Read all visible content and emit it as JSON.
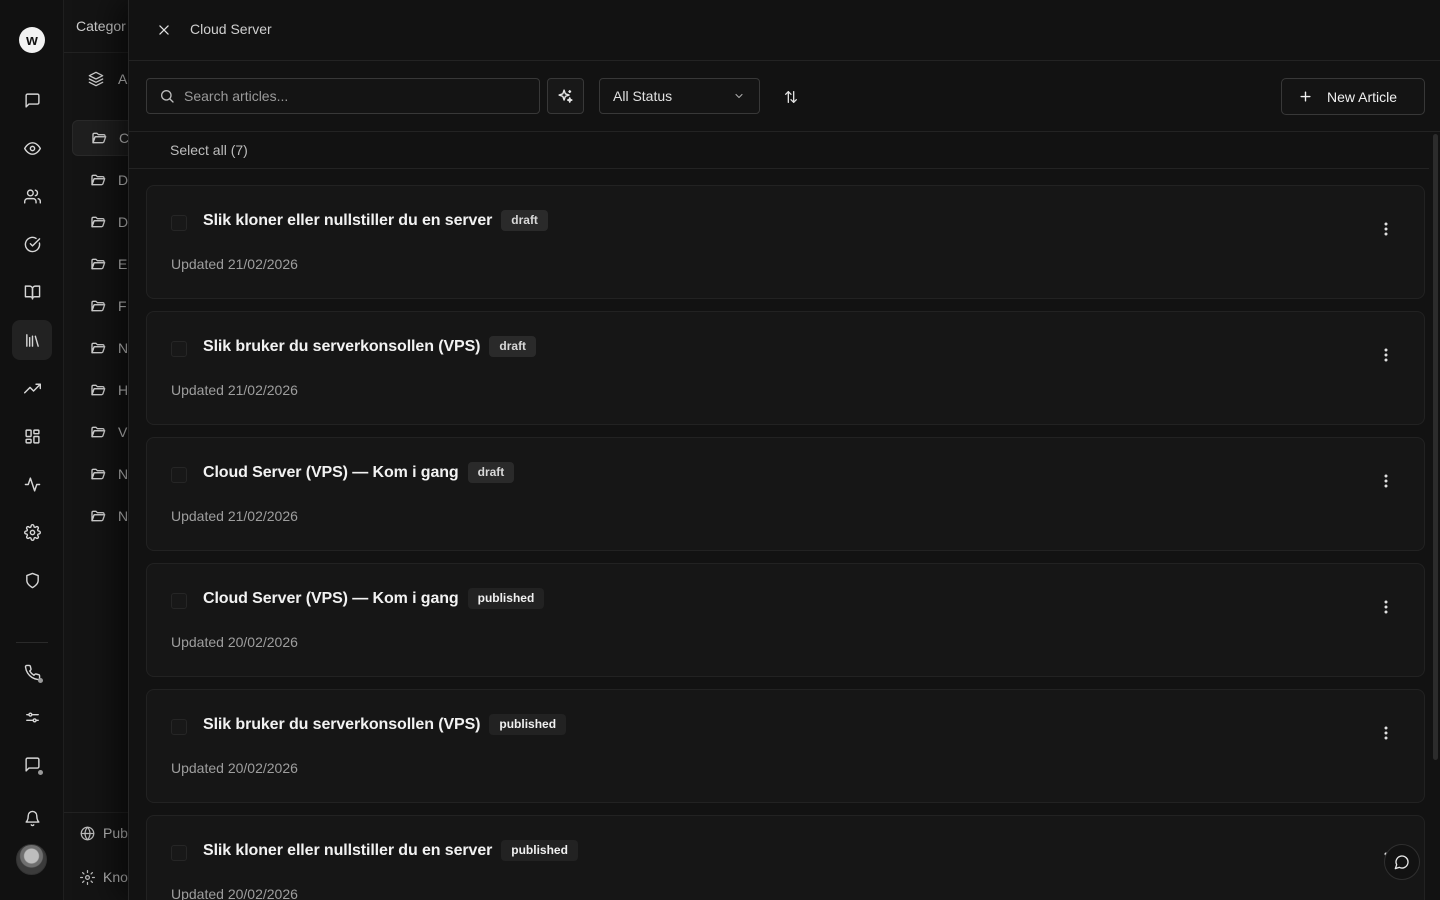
{
  "app": {
    "logo_letter": "w"
  },
  "category_panel": {
    "title": "Categor",
    "all_label": "A",
    "items": [
      {
        "label": "C"
      },
      {
        "label": "D"
      },
      {
        "label": "D"
      },
      {
        "label": "E"
      },
      {
        "label": "F"
      },
      {
        "label": "N"
      },
      {
        "label": "H"
      },
      {
        "label": "V"
      },
      {
        "label": "N"
      },
      {
        "label": "N"
      }
    ],
    "footer_publish": "Pub",
    "footer_knowledge": "Kno"
  },
  "drawer": {
    "title": "Cloud Server",
    "search_placeholder": "Search articles...",
    "status_filter": "All Status",
    "new_article_label": "New Article",
    "select_all_label": "Select all (7)"
  },
  "articles": [
    {
      "title": "Slik kloner eller nullstiller du en server",
      "status": "draft",
      "updated": "Updated 21/02/2026"
    },
    {
      "title": "Slik bruker du serverkonsollen (VPS)",
      "status": "draft",
      "updated": "Updated 21/02/2026"
    },
    {
      "title": "Cloud Server (VPS) — Kom i gang",
      "status": "draft",
      "updated": "Updated 21/02/2026"
    },
    {
      "title": "Cloud Server (VPS) — Kom i gang",
      "status": "published",
      "updated": "Updated 20/02/2026"
    },
    {
      "title": "Slik bruker du serverkonsollen (VPS)",
      "status": "published",
      "updated": "Updated 20/02/2026"
    },
    {
      "title": "Slik kloner eller nullstiller du en server",
      "status": "published",
      "updated": "Updated 20/02/2026"
    }
  ],
  "colors": {
    "background": "#0f0f0f",
    "drawer": "#121212",
    "card": "#161616",
    "border": "#222222",
    "text": "#f2f2f2"
  }
}
